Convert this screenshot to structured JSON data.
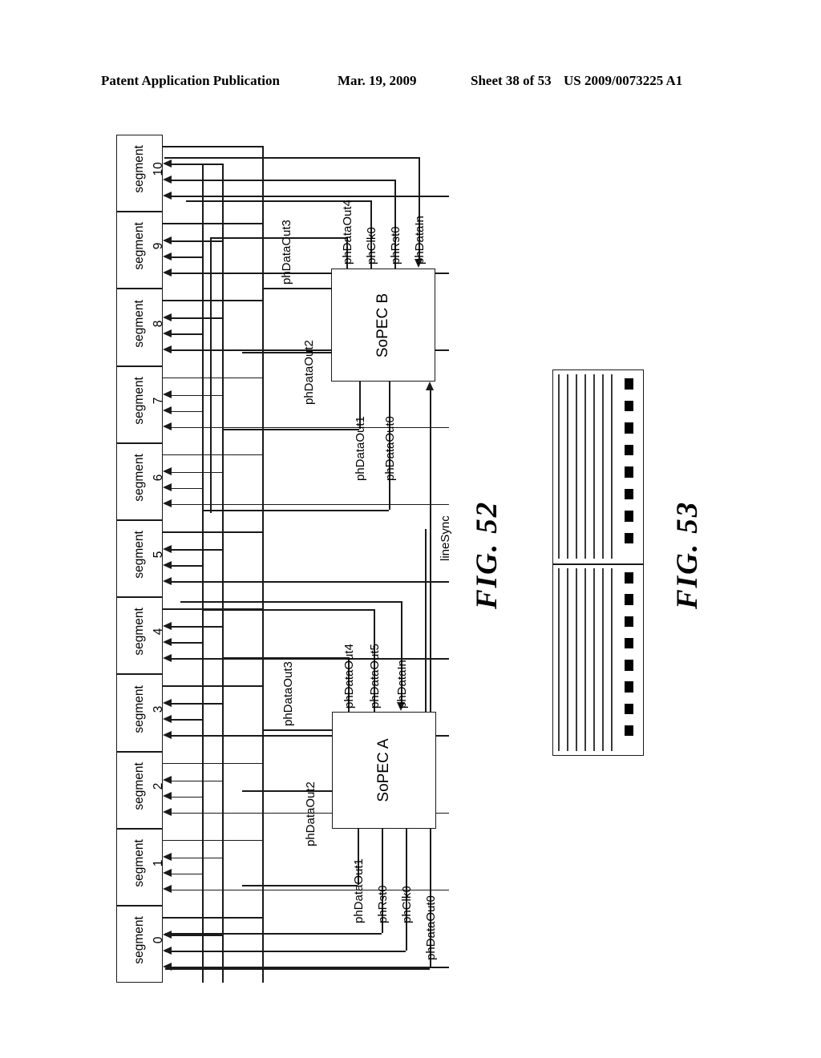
{
  "header": {
    "publication": "Patent Application Publication",
    "date": "Mar. 19, 2009",
    "sheet": "Sheet 38 of 53",
    "docnum": "US 2009/0073225 A1"
  },
  "fig52": {
    "caption": "FIG. 52",
    "segments": [
      {
        "name": "segment",
        "index": "10"
      },
      {
        "name": "segment",
        "index": "9"
      },
      {
        "name": "segment",
        "index": "8"
      },
      {
        "name": "segment",
        "index": "7"
      },
      {
        "name": "segment",
        "index": "6"
      },
      {
        "name": "segment",
        "index": "5"
      },
      {
        "name": "segment",
        "index": "4"
      },
      {
        "name": "segment",
        "index": "3"
      },
      {
        "name": "segment",
        "index": "2"
      },
      {
        "name": "segment",
        "index": "1"
      },
      {
        "name": "segment",
        "index": "0"
      }
    ],
    "sopec_b": {
      "label": "SoPEC B",
      "top_signals": [
        "phDataOut4",
        "phClk0",
        "phRst0",
        "phDataIn"
      ],
      "left_signals": [
        "phDataOut3",
        "phDataOut2"
      ],
      "bottom_signals": [
        "phDataOut1",
        "phDataOut0"
      ]
    },
    "sopec_a": {
      "label": "SoPEC A",
      "top_signals": [
        "phDataOut4",
        "phDataOut5",
        "phDataIn"
      ],
      "left_signals": [
        "phDataOut3",
        "phDataOut2"
      ],
      "bottom_signals": [
        "phDataOut1",
        "phRst0",
        "phClk0",
        "phDataOut0"
      ]
    },
    "line_sync_label": "lineSync"
  },
  "fig53": {
    "caption": "FIG. 53",
    "panels": 2,
    "lines_per_panel": 7,
    "dashes_per_panel": 8
  },
  "colors": {
    "ink": "#1a1a1a",
    "paper": "#ffffff"
  }
}
